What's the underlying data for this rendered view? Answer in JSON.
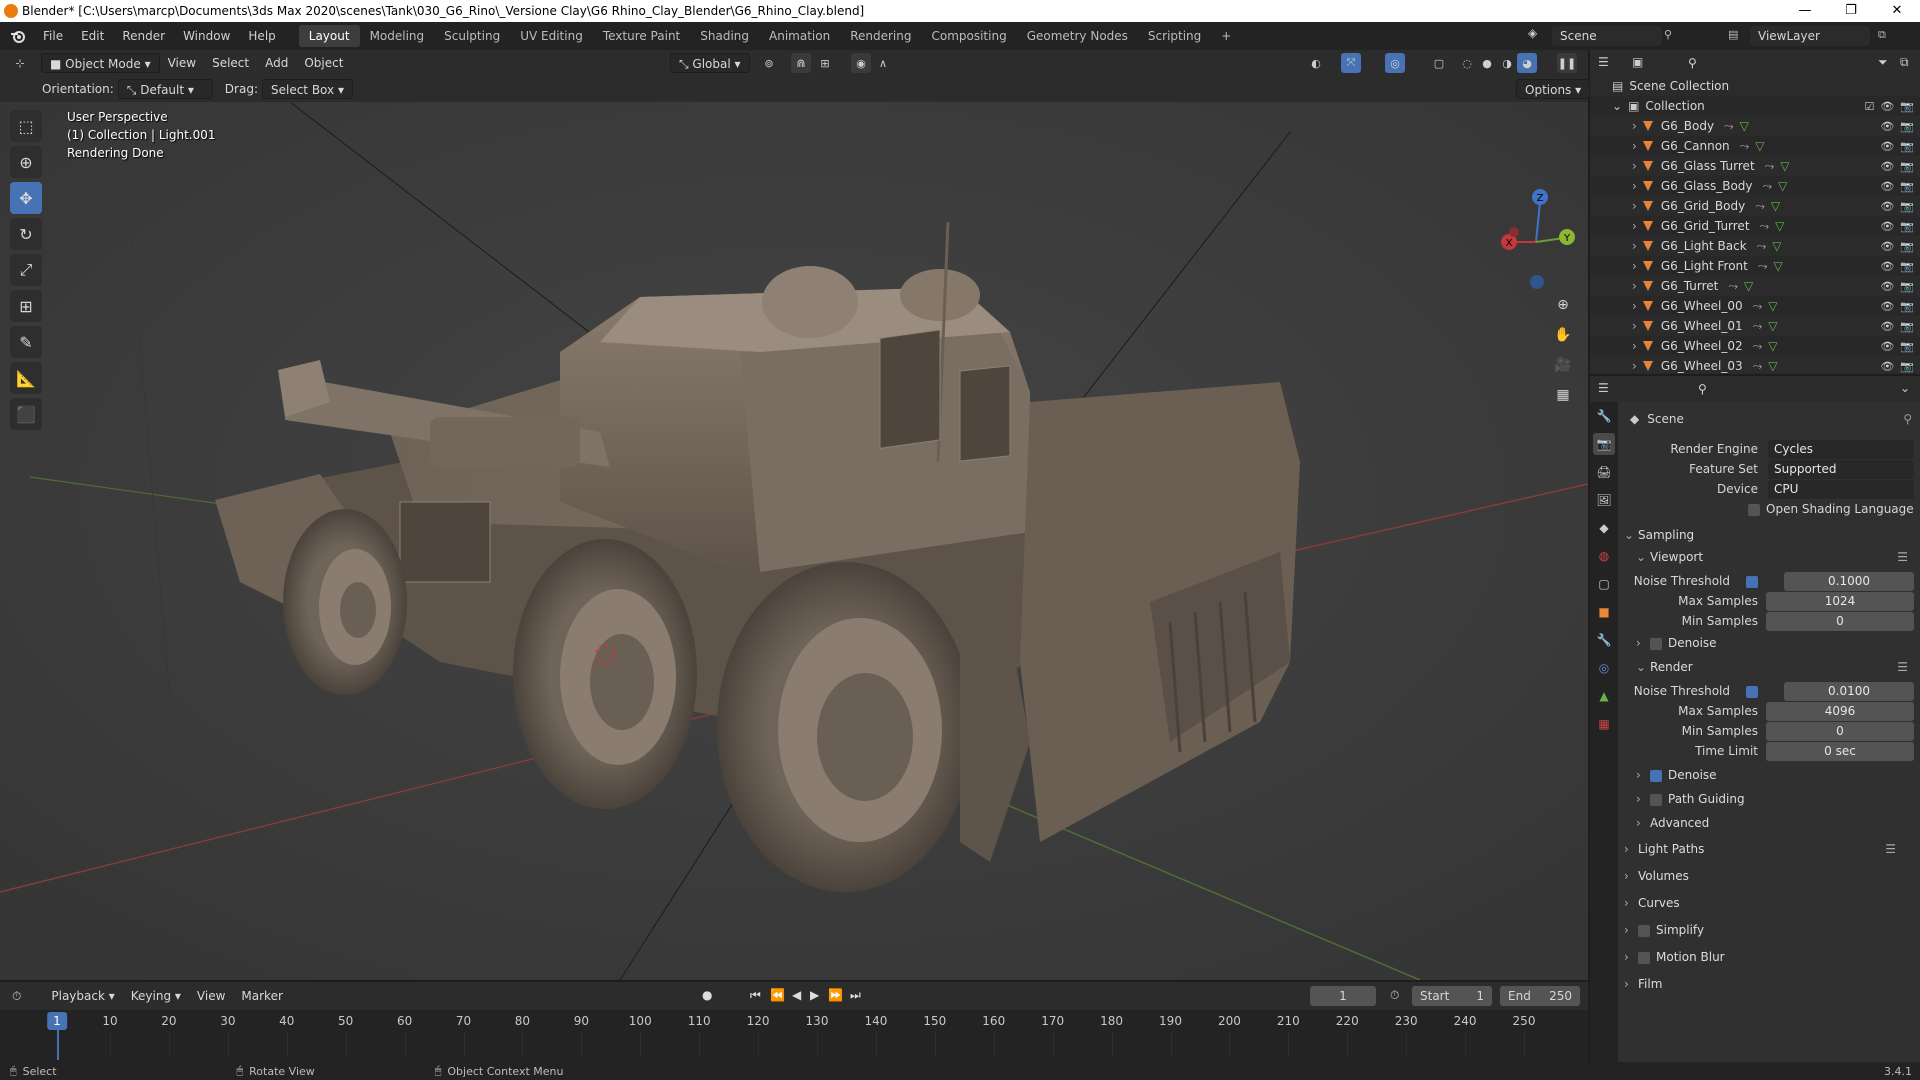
{
  "titlebar": {
    "title": "Blender* [C:\\Users\\marcp\\Documents\\3ds Max 2020\\scenes\\Tank\\030_G6_Rino\\_Versione Clay\\G6 Rhino_Clay_Blender\\G6_Rhino_Clay.blend]",
    "minimize": "—",
    "maximize": "❐",
    "close": "✕"
  },
  "menu": {
    "items": [
      "File",
      "Edit",
      "Render",
      "Window",
      "Help"
    ],
    "workspaces": [
      "Layout",
      "Modeling",
      "Sculpting",
      "UV Editing",
      "Texture Paint",
      "Shading",
      "Animation",
      "Rendering",
      "Compositing",
      "Geometry Nodes",
      "Scripting"
    ],
    "active_workspace": "Layout",
    "add_tab": "+",
    "scene": "Scene",
    "view_layer": "ViewLayer"
  },
  "viewport_header": {
    "mode": "Object Mode",
    "menus": [
      "View",
      "Select",
      "Add",
      "Object"
    ],
    "transform_orientation": "Global",
    "orientation_label": "Orientation:",
    "orientation_value": "Default",
    "drag_label": "Drag:",
    "drag_value": "Select Box",
    "options": "Options"
  },
  "viewport": {
    "overlay_lines": [
      "User Perspective",
      "(1) Collection | Light.001",
      "Rendering Done"
    ],
    "gizmo": {
      "x": "X",
      "y": "Y",
      "z": "Z"
    }
  },
  "outliner": {
    "scene_collection": "Scene Collection",
    "collection": "Collection",
    "objects": [
      "G6_Body",
      "G6_Cannon",
      "G6_Glass Turret",
      "G6_Glass_Body",
      "G6_Grid_Body",
      "G6_Grid_Turret",
      "G6_Light Back",
      "G6_Light Front",
      "G6_Turret",
      "G6_Wheel_00",
      "G6_Wheel_01",
      "G6_Wheel_02",
      "G6_Wheel_03"
    ]
  },
  "properties": {
    "context": "Scene",
    "render_engine_label": "Render Engine",
    "render_engine": "Cycles",
    "feature_set_label": "Feature Set",
    "feature_set": "Supported",
    "device_label": "Device",
    "device": "CPU",
    "osl_label": "Open Shading Language",
    "osl_checked": false,
    "sampling": {
      "title": "Sampling",
      "viewport": {
        "title": "Viewport",
        "noise_threshold_label": "Noise Threshold",
        "noise_threshold": "0.1000",
        "noise_checked": true,
        "max_samples_label": "Max Samples",
        "max_samples": "1024",
        "min_samples_label": "Min Samples",
        "min_samples": "0",
        "denoise_label": "Denoise",
        "denoise_checked": false
      },
      "render": {
        "title": "Render",
        "noise_threshold_label": "Noise Threshold",
        "noise_threshold": "0.0100",
        "noise_checked": true,
        "max_samples_label": "Max Samples",
        "max_samples": "4096",
        "min_samples_label": "Min Samples",
        "min_samples": "0",
        "time_limit_label": "Time Limit",
        "time_limit": "0 sec",
        "denoise_label": "Denoise",
        "denoise_checked": true,
        "path_guiding_label": "Path Guiding",
        "path_guiding_checked": false,
        "advanced_label": "Advanced"
      }
    },
    "sections": [
      "Light Paths",
      "Volumes",
      "Curves",
      "Simplify",
      "Motion Blur",
      "Film"
    ]
  },
  "timeline": {
    "menus": [
      "Playback",
      "Keying",
      "View",
      "Marker"
    ],
    "current_frame": "1",
    "start_label": "Start",
    "start": "1",
    "end_label": "End",
    "end": "250",
    "ticks": [
      "1",
      "10",
      "20",
      "30",
      "40",
      "50",
      "60",
      "70",
      "80",
      "90",
      "100",
      "110",
      "120",
      "130",
      "140",
      "150",
      "160",
      "170",
      "180",
      "190",
      "200",
      "210",
      "220",
      "230",
      "240",
      "250"
    ]
  },
  "statusbar": {
    "select": "Select",
    "rotate_view": "Rotate View",
    "context_menu": "Object Context Menu",
    "version": "3.4.1"
  }
}
